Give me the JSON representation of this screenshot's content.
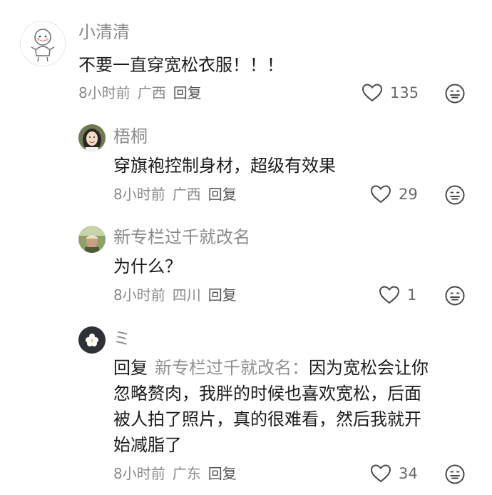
{
  "comments": [
    {
      "username": "小清清",
      "content": "不要一直穿宽松衣服！！！",
      "time": "8小时前",
      "location": "广西",
      "reply_label": "回复",
      "likes": "135",
      "avatar_icon": "cartoon-baby-avatar"
    },
    {
      "username": "梧桐",
      "content": "穿旗袍控制身材，超级有效果",
      "time": "8小时前",
      "location": "广西",
      "reply_label": "回复",
      "likes": "29",
      "avatar_icon": "girl-photo-avatar"
    },
    {
      "username": "新专栏过千就改名",
      "content": "为什么？",
      "time": "8小时前",
      "location": "四川",
      "reply_label": "回复",
      "likes": "1",
      "avatar_icon": "outdoor-photo-avatar"
    },
    {
      "username": "ミ",
      "reply_prefix": "回复",
      "reply_target": "新专栏过千就改名：",
      "content_lines": [
        "因为宽松会让你",
        "忽略赘肉，我胖的时候也喜欢宽松，后面",
        "被人拍了照片，真的很难看，然后我就开",
        "始减脂了"
      ],
      "time": "8小时前",
      "location": "广东",
      "reply_label": "回复",
      "likes": "34",
      "avatar_icon": "flower-avatar"
    }
  ],
  "icons": {
    "like": "heart-outline-icon",
    "emoji": "emoji-face-icon"
  },
  "colors": {
    "username": "#8a8a8a",
    "text": "#1b1b1b",
    "meta": "#8a8a8a"
  }
}
